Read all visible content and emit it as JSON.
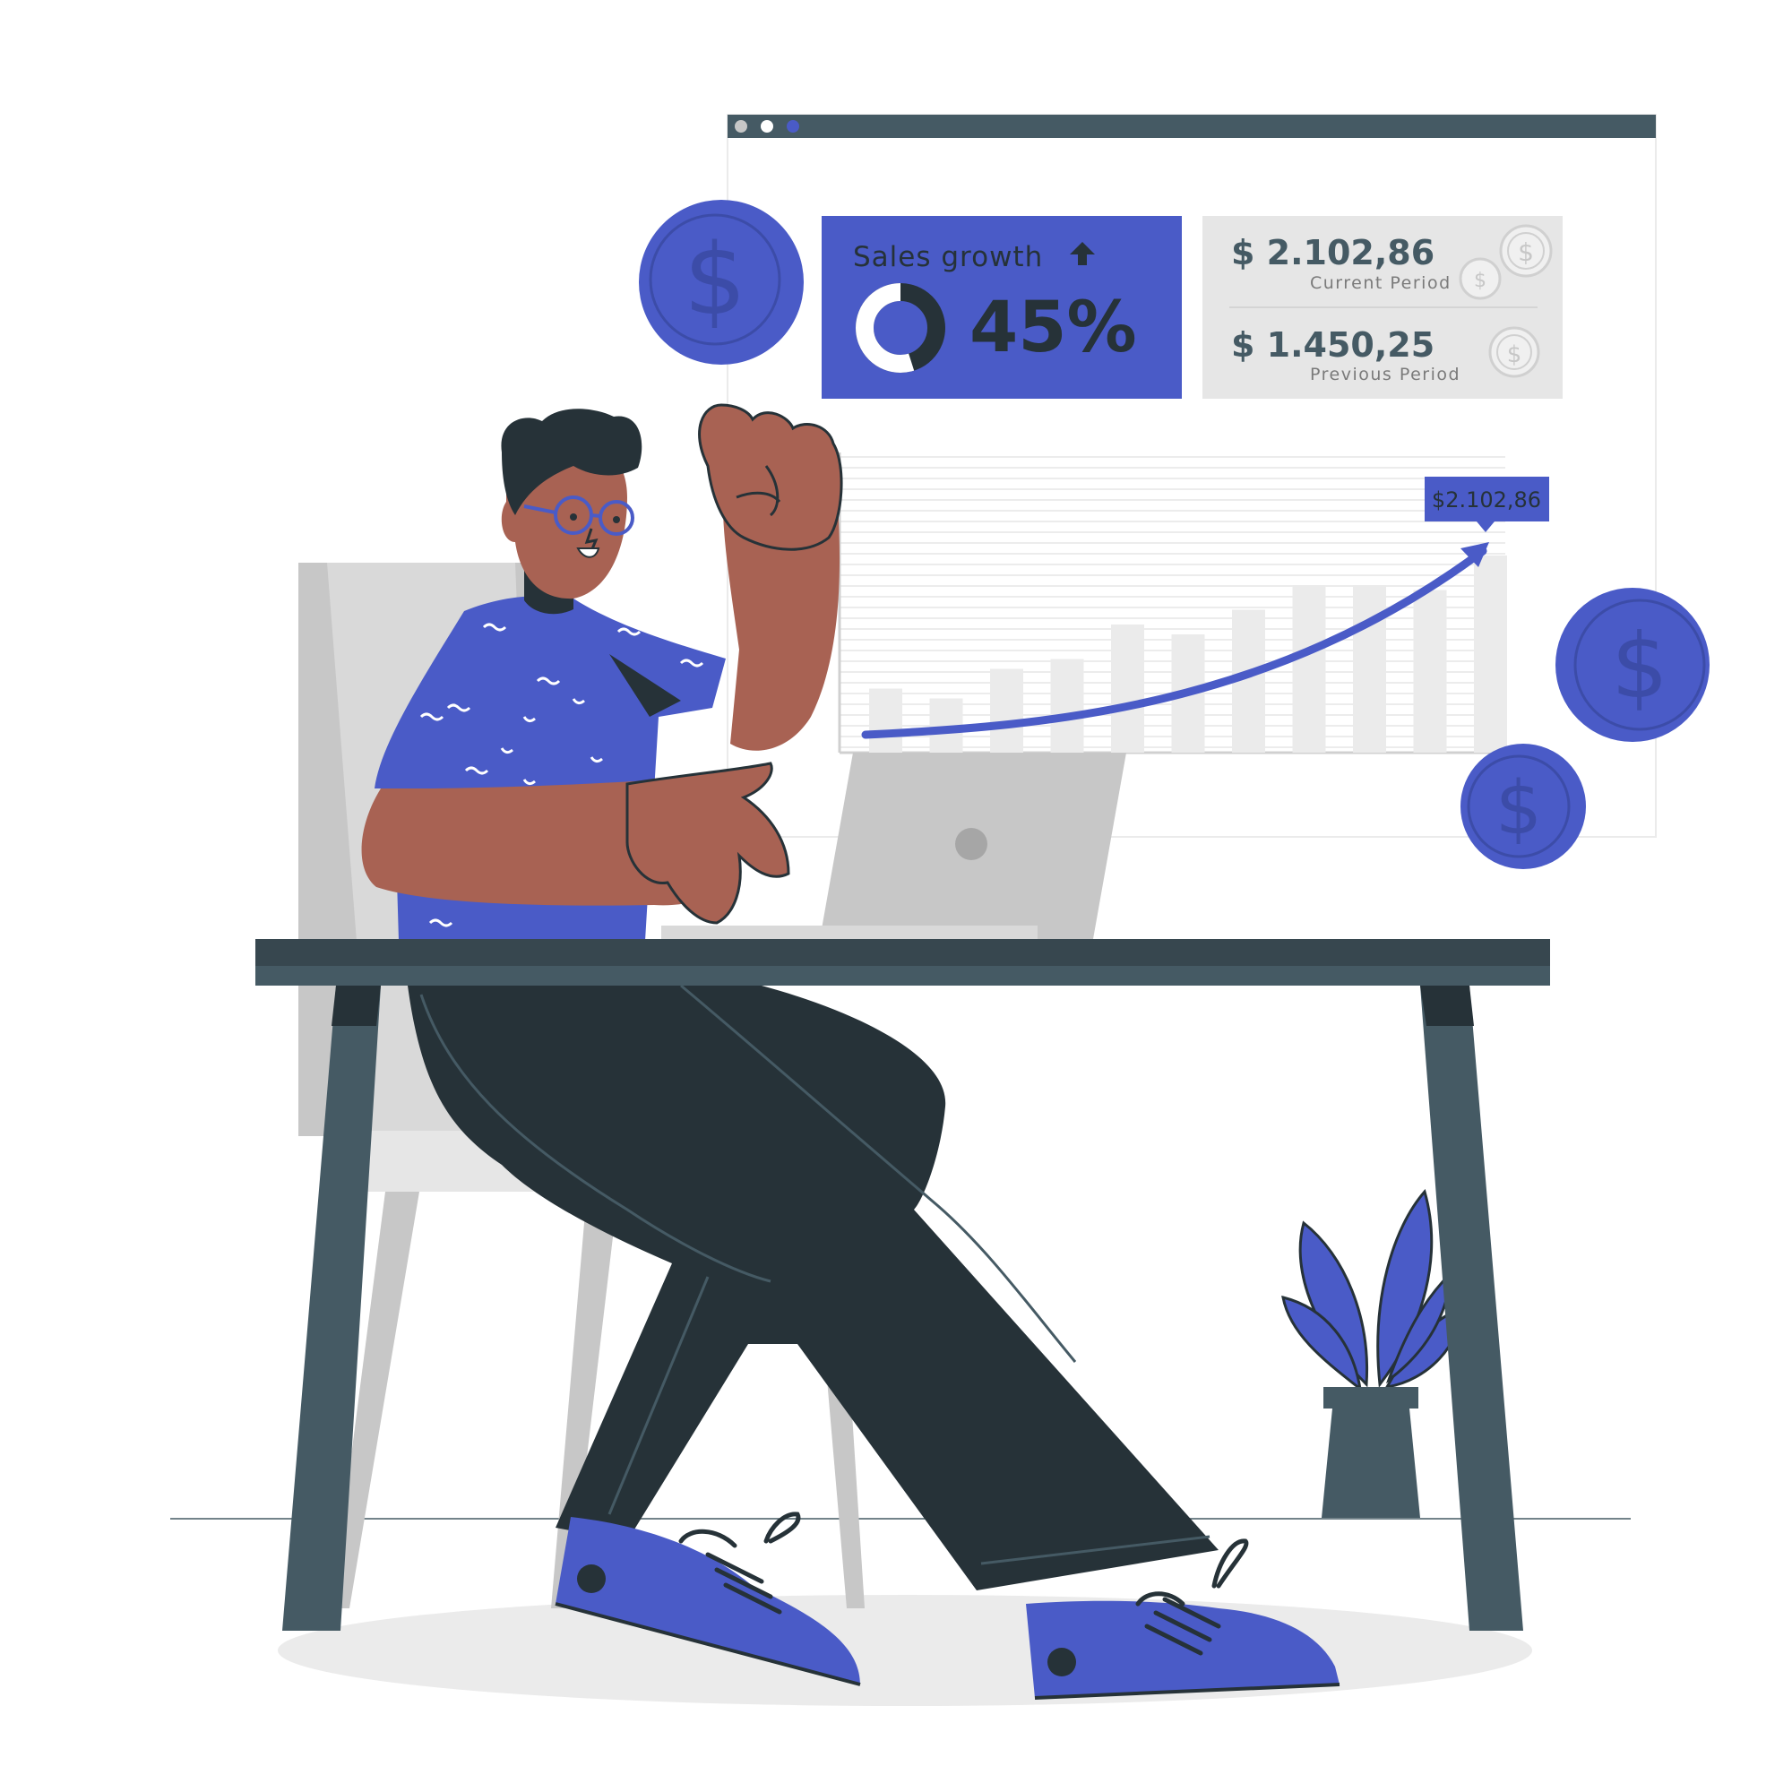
{
  "colors": {
    "accent": "#4a5bc7",
    "dark": "#263238",
    "slate": "#455a64",
    "skin": "#a86253",
    "light_gray": "#ebebeb",
    "mid_gray": "#c7c7c7",
    "card_gray": "#e6e6e6"
  },
  "browser": {
    "dots": [
      "gray",
      "white",
      "blue"
    ]
  },
  "sales_card": {
    "title": "Sales growth",
    "trend_icon": "arrow-up-icon",
    "percent_label": "45%",
    "percent_value": 45
  },
  "period_card": {
    "current": {
      "amount": "$ 2.102,86",
      "label": "Current Period"
    },
    "previous": {
      "amount": "$ 1.450,25",
      "label": "Previous Period"
    },
    "icon": "dollar-coin-icon"
  },
  "chart": {
    "tooltip": "$2.102,86",
    "bar_levels": [
      0.26,
      0.22,
      0.34,
      0.38,
      0.52,
      0.48,
      0.58,
      0.68,
      0.68,
      0.66,
      0.8
    ],
    "trend_icon": "trend-arrow-icon"
  },
  "decor": {
    "coins": [
      "dollar-coin-icon",
      "dollar-coin-icon",
      "dollar-coin-icon"
    ],
    "person": "man-celebrating-illustration",
    "laptop": "laptop-icon",
    "plant": "potted-plant-icon"
  }
}
